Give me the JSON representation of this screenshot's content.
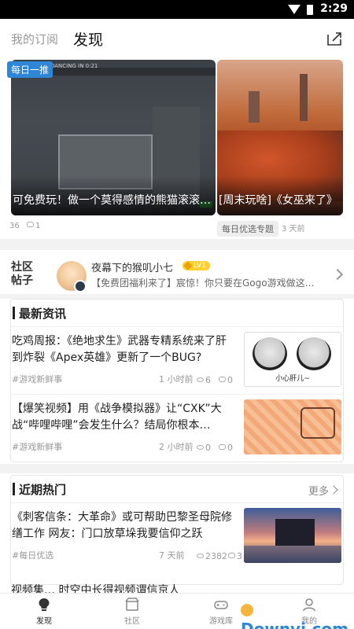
{
  "status_bar": {
    "time": "2:29"
  },
  "header": {
    "tab_subscribed": "我的订阅",
    "tab_discover": "发现"
  },
  "banner": {
    "badge": "每日一推",
    "slides": [
      {
        "title": "可免费玩！做一个莫得感情的熊猫滚滚…"
      },
      {
        "title": "[周末玩啥]《女巫来了》"
      }
    ],
    "hud_text": "DANCING IN 0:21",
    "meta": {
      "count": "36",
      "comments": "1",
      "topic": "每日优选专题",
      "time": "3 天前"
    }
  },
  "community": {
    "label": "社区帖子",
    "username": "夜幕下的猴叽小七",
    "level": "LV1",
    "post": "【免费团福利来了】宸惊！你只要在Gogo游戏做这…"
  },
  "news": {
    "title": "最新资讯",
    "articles": [
      {
        "title": "吃鸡周报：《绝地求生》武器专精系统来了肝到炸裂《Apex英雄》更新了一个BUG?",
        "tag": "#游戏新鲜事",
        "time": "1 小时前",
        "views": "6",
        "comments": "0",
        "thumb_caption": "小心肝儿~"
      },
      {
        "title": "【爆笑视频】用《战争模拟器》让“CXK”大战“哔哩哔哩”会发生什么？结局你根本…",
        "tag": "#游戏新鲜事",
        "time": "2 小时前",
        "views": "0",
        "comments": "0"
      }
    ]
  },
  "hot": {
    "title": "近期热门",
    "more": "更多",
    "articles": [
      {
        "title": "《刺客信条：大革命》或可帮助巴黎圣母院修缮工作 网友：门口放草垛我要信仰之跃",
        "tag": "#每日优选",
        "time": "7 天前",
        "views": "2382",
        "comments": "3"
      }
    ],
    "peek_title": "视频集… 时空中长得视频谓信京人 "
  },
  "bottom_nav": [
    {
      "label": "发现",
      "icon": "lightbulb-icon",
      "active": true
    },
    {
      "label": "社区",
      "icon": "community-icon",
      "active": false
    },
    {
      "label": "游戏库",
      "icon": "gamepad-icon",
      "active": false
    },
    {
      "label": "我的",
      "icon": "profile-icon",
      "active": false
    }
  ],
  "watermark": "Downyi.com",
  "colors": {
    "accent": "#2f86d6",
    "level_badge": "#ffcf2d"
  }
}
